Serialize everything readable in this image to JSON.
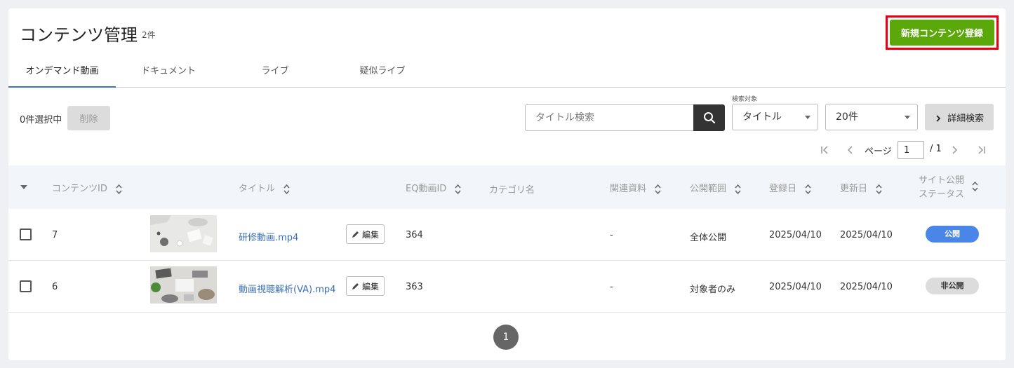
{
  "header": {
    "title": "コンテンツ管理",
    "count": "2件",
    "new_button": "新規コンテンツ登録"
  },
  "tabs": [
    {
      "label": "オンデマンド動画",
      "active": true
    },
    {
      "label": "ドキュメント",
      "active": false
    },
    {
      "label": "ライブ",
      "active": false
    },
    {
      "label": "疑似ライブ",
      "active": false
    }
  ],
  "toolbar": {
    "selected": "0件選択中",
    "delete_label": "削除",
    "search_placeholder": "タイトル検索",
    "target_label": "検索対象",
    "target_value": "タイトル",
    "per_page_value": "20件",
    "advanced_label": "詳細検索"
  },
  "pager": {
    "page_label": "ページ",
    "current": "1",
    "total": "/ 1"
  },
  "table": {
    "columns": {
      "id": "コンテンツID",
      "title": "タイトル",
      "eq_id": "EQ動画ID",
      "category": "カテゴリ名",
      "related": "関連資料",
      "scope": "公開範囲",
      "created": "登録日",
      "updated": "更新日",
      "status_line1": "サイト公開",
      "status_line2": "ステータス"
    },
    "edit_label": "編集",
    "rows": [
      {
        "id": "7",
        "title": "研修動画.mp4",
        "eq_id": "364",
        "category": "",
        "related": "-",
        "scope": "全体公開",
        "created": "2025/04/10",
        "updated": "2025/04/10",
        "status": "公開"
      },
      {
        "id": "6",
        "title": "動画視聴解析(VA).mp4",
        "eq_id": "363",
        "category": "",
        "related": "-",
        "scope": "対象者のみ",
        "created": "2025/04/10",
        "updated": "2025/04/10",
        "status": "非公開"
      }
    ]
  },
  "pagination": {
    "current": "1"
  },
  "colors": {
    "accent_green": "#5ba80a",
    "highlight_red": "#e60012",
    "link_blue": "#3a6fb8",
    "public_badge": "#4a86e8",
    "private_badge": "#dcdcdc"
  },
  "icons": [
    "search-icon",
    "chevron-down-icon",
    "chevron-right-icon",
    "first-page-icon",
    "prev-page-icon",
    "next-page-icon",
    "last-page-icon",
    "sort-icon",
    "pencil-icon",
    "checkbox-icon"
  ]
}
